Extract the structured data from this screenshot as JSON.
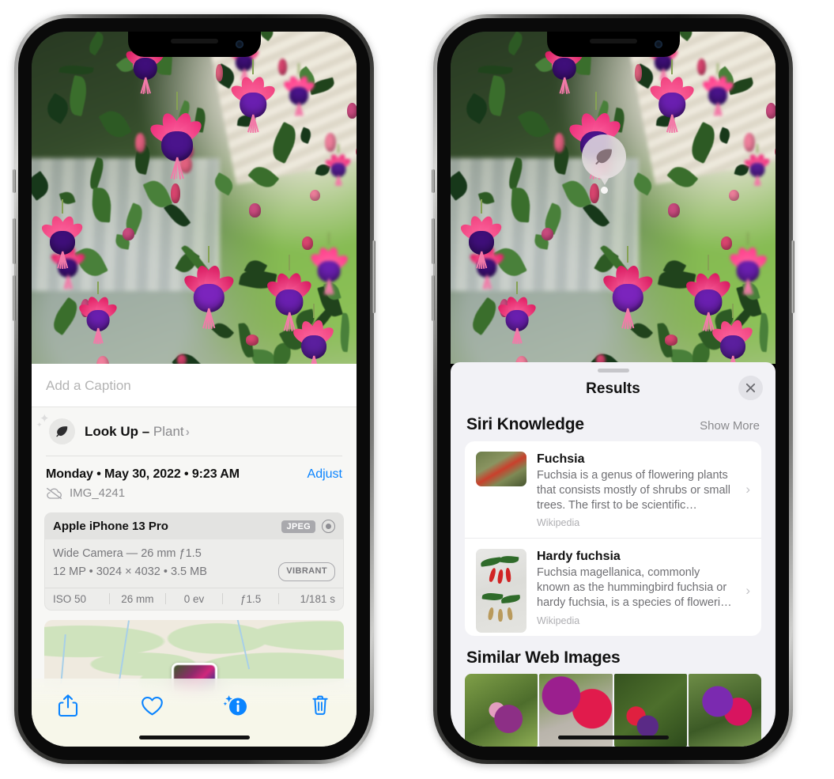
{
  "left_phone": {
    "caption": {
      "placeholder": "Add a Caption",
      "value": ""
    },
    "lookup": {
      "label": "Look Up –",
      "subject": "Plant",
      "chevron": "›",
      "icon": "leaf-icon"
    },
    "date": "Monday • May 30, 2022 • 9:23 AM",
    "adjust_label": "Adjust",
    "file_name": "IMG_4241",
    "file_icon": "cloud-slash-icon",
    "metadata": {
      "device": "Apple iPhone 13 Pro",
      "format_badge": "JPEG",
      "hdr_icon": "hdr-circle-icon",
      "lens_line": "Wide Camera — 26 mm ƒ1.5",
      "size_line": "12 MP • 3024 × 4032 • 3.5 MB",
      "style_badge": "VIBRANT",
      "exif": [
        "ISO 50",
        "26 mm",
        "0 ev",
        "ƒ1.5",
        "1/181 s"
      ]
    },
    "toolbar": [
      {
        "name": "share-button",
        "icon": "share-icon"
      },
      {
        "name": "favorite-button",
        "icon": "heart-icon"
      },
      {
        "name": "info-button",
        "icon": "info-sparkle-icon"
      },
      {
        "name": "delete-button",
        "icon": "trash-icon"
      }
    ]
  },
  "right_phone": {
    "visual_lookup_badge": {
      "icon": "leaf-icon"
    },
    "sheet": {
      "title": "Results",
      "close_icon": "close-icon",
      "siri_knowledge": {
        "title": "Siri Knowledge",
        "show_more": "Show More",
        "items": [
          {
            "title": "Fuchsia",
            "description": "Fuchsia is a genus of flowering plants that consists mostly of shrubs or small trees. The first to be scientific…",
            "source": "Wikipedia",
            "chevron": "›"
          },
          {
            "title": "Hardy fuchsia",
            "description": "Fuchsia magellanica, commonly known as the hummingbird fuchsia or hardy fuchsia, is a species of floweri…",
            "source": "Wikipedia",
            "chevron": "›"
          }
        ]
      },
      "similar_web_images": {
        "title": "Similar Web Images",
        "count": 4
      }
    }
  },
  "colors": {
    "accent_blue": "#0a84ff",
    "sheet_bg": "#f7f7f5",
    "results_bg": "#f2f2f6",
    "card_white": "#ffffff",
    "secondary_text": "#8a8a8d",
    "badge_gray": "#a9a9ad"
  }
}
